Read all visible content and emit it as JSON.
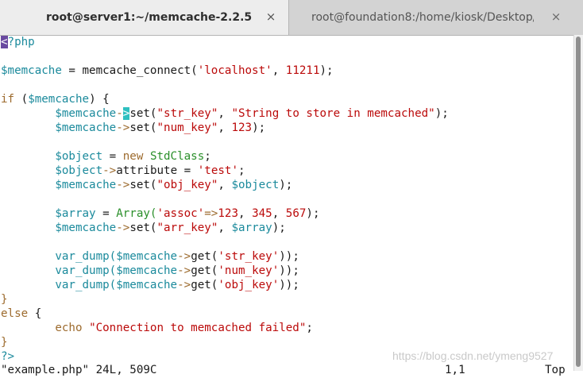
{
  "tabs": [
    {
      "title": "root@server1:~/memcache-2.2.5",
      "close": "×",
      "active": true
    },
    {
      "title": "root@foundation8:/home/kiosk/Desktop/...",
      "close": "×",
      "active": false
    }
  ],
  "code": {
    "l1_lt": "<",
    "l1_rest": "?php",
    "l3_var": "$memcache",
    "l3_eq": " = memcache_connect(",
    "l3_str": "'localhost'",
    "l3_comma": ", ",
    "l3_num": "11211",
    "l3_end": ");",
    "l5_if": "if",
    "l5_paren": " (",
    "l5_var": "$memcache",
    "l5_close": ") {",
    "l6_var": "$memcache",
    "l6_arrow_a": "-",
    "l6_arrow_cursor": ">",
    "l6_set": "set(",
    "l6_s1": "\"str_key\"",
    "l6_c": ", ",
    "l6_s2": "\"String to store in memcached\"",
    "l6_end": ");",
    "l7_var": "$memcache",
    "l7_arrow": "->",
    "l7_set": "set(",
    "l7_s1": "\"num_key\"",
    "l7_c": ", ",
    "l7_num": "123",
    "l7_end": ");",
    "l9_var": "$object",
    "l9_eq": " = ",
    "l9_new": "new",
    "l9_cls": "StdClass",
    "l9_end": ";",
    "l10_var": "$object",
    "l10_arrow": "->",
    "l10_attr": "attribute = ",
    "l10_str": "'test'",
    "l10_end": ";",
    "l11_var": "$memcache",
    "l11_arrow": "->",
    "l11_set": "set(",
    "l11_s1": "\"obj_key\"",
    "l11_c": ", ",
    "l11_var2": "$object",
    "l11_end": ");",
    "l13_var": "$array",
    "l13_eq": " = ",
    "l13_cls": "Array(",
    "l13_str": "'assoc'",
    "l13_op": "=>",
    "l13_n1": "123",
    "l13_c1": ", ",
    "l13_n2": "345",
    "l13_c2": ", ",
    "l13_n3": "567",
    "l13_end": ");",
    "l14_var": "$memcache",
    "l14_arrow": "->",
    "l14_set": "set(",
    "l14_s1": "\"arr_key\"",
    "l14_c": ", ",
    "l14_var2": "$array",
    "l14_end": ");",
    "l16_fn": "var_dump(",
    "l16_var": "$memcache",
    "l16_arrow": "->",
    "l16_get": "get(",
    "l16_str": "'str_key'",
    "l16_end": "));",
    "l17_fn": "var_dump(",
    "l17_var": "$memcache",
    "l17_arrow": "->",
    "l17_get": "get(",
    "l17_str": "'num_key'",
    "l17_end": "));",
    "l18_fn": "var_dump(",
    "l18_var": "$memcache",
    "l18_arrow": "->",
    "l18_get": "get(",
    "l18_str": "'obj_key'",
    "l18_end": "));",
    "l19_brace": "}",
    "l20_else": "else",
    "l20_brace": " {",
    "l21_echo": "echo",
    "l21_str": "\"Connection to memcached failed\"",
    "l21_end": ";",
    "l22_brace": "}",
    "l23_tag": "?>"
  },
  "status": {
    "file": "\"example.php\" 24L, 509C",
    "pos": "1,1",
    "pct": "Top"
  },
  "watermark": "https://blog.csdn.net/ymeng9527"
}
